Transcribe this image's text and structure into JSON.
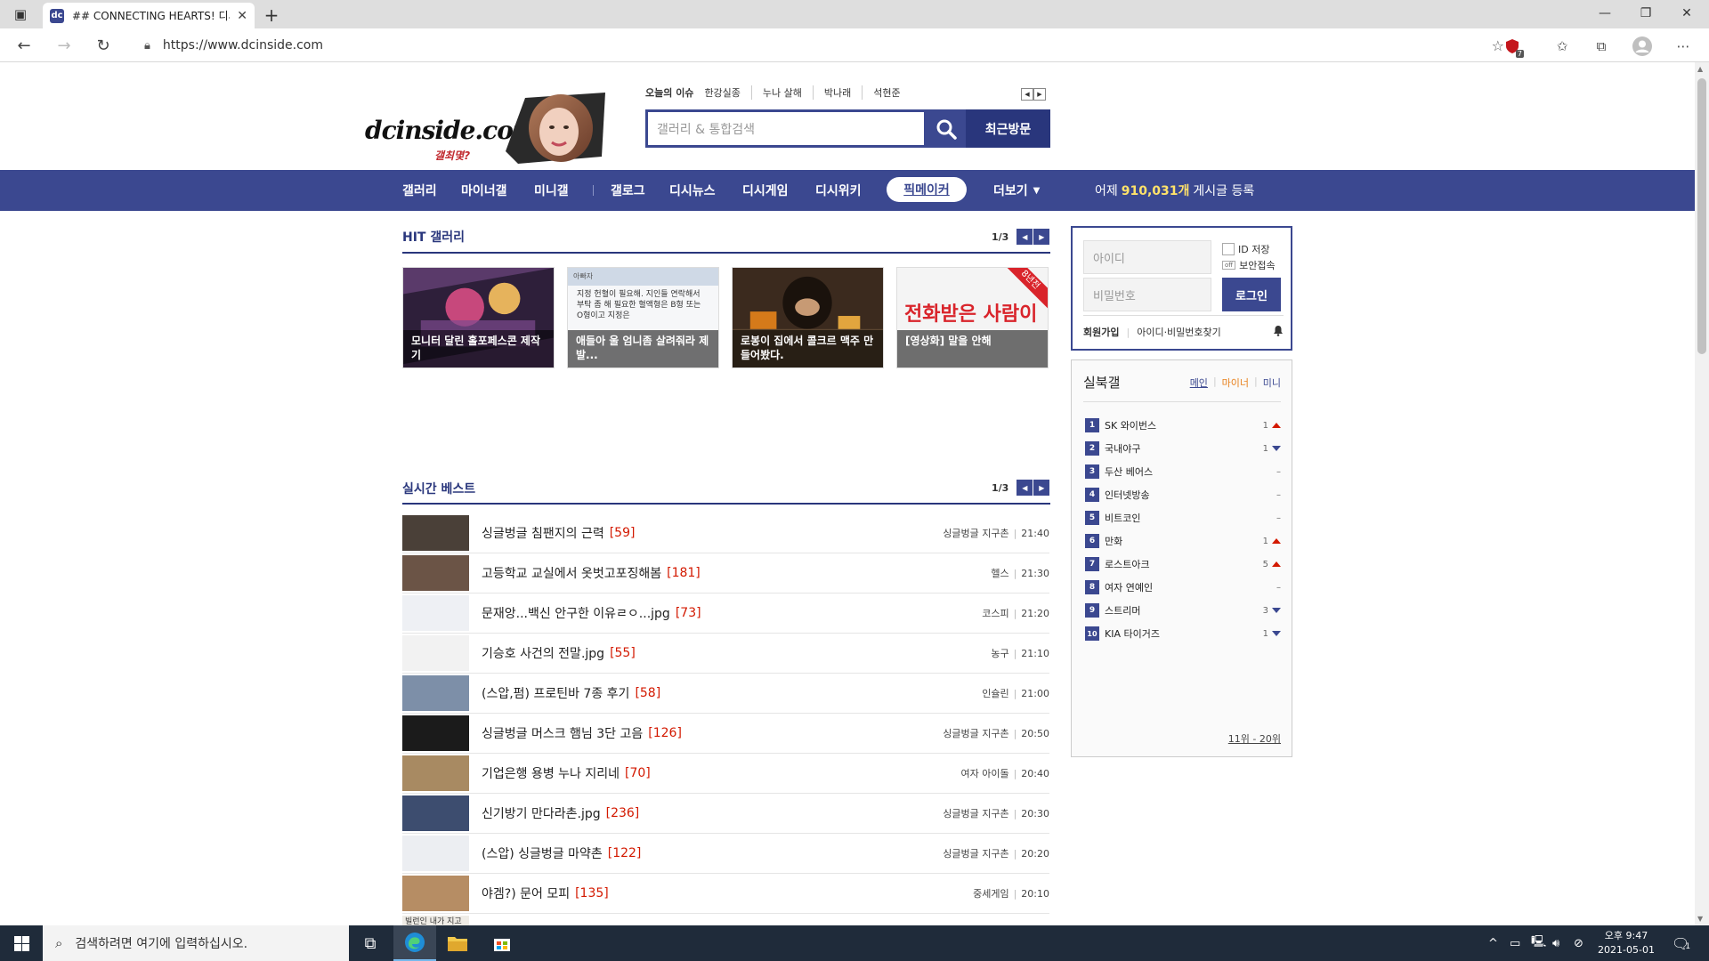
{
  "browser": {
    "tab_title": "## CONNECTING HEARTS! 디시인사이드",
    "tab_favicon": "dc",
    "url": "https://www.dcinside.com",
    "notification_count": "7"
  },
  "header": {
    "logo_text": "dcinside.com",
    "logo_sub": "갤최몇?",
    "issue_label": "오늘의 이슈",
    "issues": [
      "한강실종",
      "누나 살해",
      "박나래",
      "석현준"
    ],
    "search_placeholder": "갤러리 & 통합검색",
    "recent_label": "최근방문"
  },
  "gnb": {
    "items": [
      "갤러리",
      "마이너갤",
      "미니갤",
      "갤로그",
      "디시뉴스",
      "디시게임",
      "디시위키",
      "픽메이커",
      "더보기"
    ],
    "stat_prefix": "어제",
    "stat_count": "910,031개",
    "stat_suffix": "게시글 등록"
  },
  "hit": {
    "title": "HIT 갤러리",
    "page": "1/3",
    "cards": [
      {
        "caption": "모니터 달린 홀포페스콘 제작기",
        "colors": [
          "#5a3a6a",
          "#c7487c"
        ]
      },
      {
        "caption": "애들아 울 엄니좀 살려줘라 제발...",
        "colors": [
          "#e8e8e8",
          "#cfd9e6"
        ],
        "snippet": "지정 헌혈이 필요해. 지인들 연락해서 부탁 좀 해 필요한 혈액형은 B형 또는 O형이고 지정은",
        "author": "아빠자"
      },
      {
        "caption": "로봉이 집에서 콜크르 맥주 만들어봤다.",
        "colors": [
          "#3b2a1e",
          "#8b6a43"
        ]
      },
      {
        "caption": "[영상화] 말을 안해",
        "colors": [
          "#f4f4f4",
          "#d8d8d8"
        ],
        "badge": "8년전",
        "art_text": "전화받은 사람이"
      }
    ]
  },
  "best": {
    "title": "실시간 베스트",
    "page": "1/3",
    "rows": [
      {
        "title": "싱글벙글 침팬지의 근력",
        "count": "[59]",
        "gallery": "싱글벙글 지구촌",
        "time": "21:40",
        "thumb": "#4a4038"
      },
      {
        "title": "고등학교 교실에서 옷벗고포징해봄",
        "count": "[181]",
        "gallery": "헬스",
        "time": "21:30",
        "thumb": "#6b5446"
      },
      {
        "title": "문재앙...백신 안구한 이유ㄹㅇ...jpg",
        "count": "[73]",
        "gallery": "코스피",
        "time": "21:20",
        "thumb": "#eef0f4"
      },
      {
        "title": "기승호 사건의 전말.jpg",
        "count": "[55]",
        "gallery": "농구",
        "time": "21:10",
        "thumb": "#f2f2f2"
      },
      {
        "title": "(스압,펌) 프로틴바 7종 후기",
        "count": "[58]",
        "gallery": "인슐린",
        "time": "21:00",
        "thumb": "#7d8fa8"
      },
      {
        "title": "싱글벙글 머스크 햄님 3단 고음",
        "count": "[126]",
        "gallery": "싱글벙글 지구촌",
        "time": "20:50",
        "thumb": "#1b1b1b"
      },
      {
        "title": "기업은행 용병 누나 지리네",
        "count": "[70]",
        "gallery": "여자 아이돌",
        "time": "20:40",
        "thumb": "#a88a62"
      },
      {
        "title": "신기방기 만다라촌.jpg",
        "count": "[236]",
        "gallery": "싱글벙글 지구촌",
        "time": "20:30",
        "thumb": "#3d4d6f"
      },
      {
        "title": "(스압) 싱글벙글 마약촌",
        "count": "[122]",
        "gallery": "싱글벙글 지구촌",
        "time": "20:20",
        "thumb": "#eceef2"
      },
      {
        "title": "야겜?) 문어 모피",
        "count": "[135]",
        "gallery": "중세게임",
        "time": "20:10",
        "thumb": "#b68d64"
      },
      {
        "title": "",
        "count": "",
        "gallery": "",
        "time": "",
        "thumb": "#efece6",
        "thumb_text": "빌런인 내가 지고 있다니 ...앤비씨"
      }
    ]
  },
  "login": {
    "id_placeholder": "아이디",
    "pw_placeholder": "비밀번호",
    "save_id": "ID 저장",
    "secure": "보안접속",
    "off_tag": "off",
    "login_btn": "로그인",
    "join": "회원가입",
    "find": "아이디·비밀번호찾기"
  },
  "rank": {
    "title": "실북갤",
    "tabs": [
      "메인",
      "마이너",
      "미니"
    ],
    "items": [
      {
        "num": "1",
        "name": "SK 와이번스",
        "change": "1",
        "dir": "up"
      },
      {
        "num": "2",
        "name": "국내야구",
        "change": "1",
        "dir": "down"
      },
      {
        "num": "3",
        "name": "두산 베어스",
        "change": "–",
        "dir": "none"
      },
      {
        "num": "4",
        "name": "인터넷방송",
        "change": "–",
        "dir": "none"
      },
      {
        "num": "5",
        "name": "비트코인",
        "change": "–",
        "dir": "none"
      },
      {
        "num": "6",
        "name": "만화",
        "change": "1",
        "dir": "up"
      },
      {
        "num": "7",
        "name": "로스트아크",
        "change": "5",
        "dir": "up"
      },
      {
        "num": "8",
        "name": "여자 연예인",
        "change": "–",
        "dir": "none"
      },
      {
        "num": "9",
        "name": "스트리머",
        "change": "3",
        "dir": "down"
      },
      {
        "num": "10",
        "name": "KIA 타이거즈",
        "change": "1",
        "dir": "down"
      }
    ],
    "more": "11위 - 20위"
  },
  "taskbar": {
    "search_placeholder": "검색하려면 여기에 입력하십시오.",
    "time": "오후 9:47",
    "date": "2021-05-01",
    "notif": "1"
  }
}
